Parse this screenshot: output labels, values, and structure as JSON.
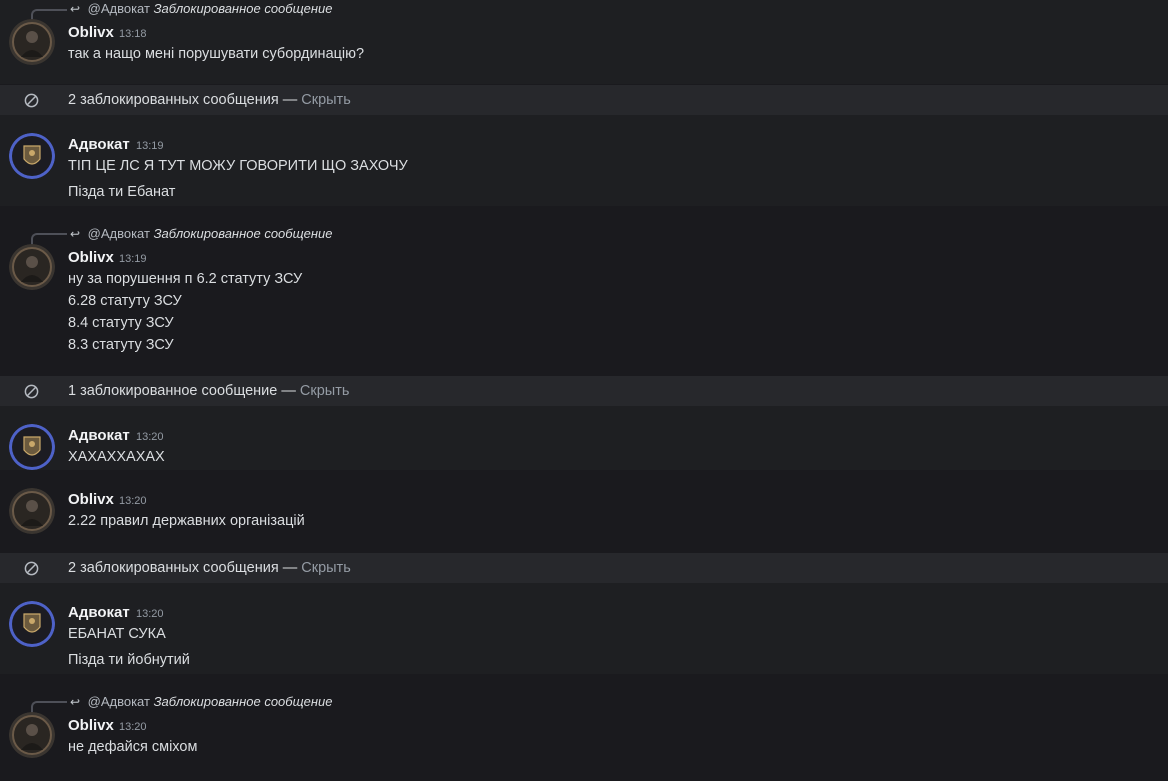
{
  "messages": [
    {
      "id": "m1",
      "reply": {
        "mention": "@Адвокат",
        "text": "Заблокированное сообщение"
      },
      "author": "Oblivx",
      "time": "13:18",
      "lines": [
        "так а нащо мені порушувати субординацію?"
      ]
    },
    {
      "id": "b1",
      "blocked_text": "2 заблокированных сообщения",
      "dash": " — ",
      "hide_label": "Скрыть"
    },
    {
      "id": "m2",
      "author": "Адвокат",
      "time": "13:19",
      "lines": [
        "ТІП ЦЕ ЛС Я ТУТ МОЖУ ГОВОРИТИ ЩО ЗАХОЧУ",
        "Пізда ти Ебанат"
      ]
    },
    {
      "id": "m3",
      "reply": {
        "mention": "@Адвокат",
        "text": "Заблокированное сообщение"
      },
      "author": "Oblivx",
      "time": "13:19",
      "lines": [
        "ну за порушення п 6.2 статуту ЗСУ",
        "6.28 статуту ЗСУ",
        "8.4 статуту ЗСУ",
        "8.3 статуту ЗСУ"
      ]
    },
    {
      "id": "b2",
      "blocked_text": "1 заблокированное сообщение",
      "dash": " — ",
      "hide_label": "Скрыть"
    },
    {
      "id": "m4",
      "author": "Адвокат",
      "time": "13:20",
      "lines": [
        "ХАХАХХАХАХ"
      ]
    },
    {
      "id": "m5",
      "author": "Oblivx",
      "time": "13:20",
      "lines": [
        "2.22 правил державних організацій"
      ]
    },
    {
      "id": "b3",
      "blocked_text": "2 заблокированных сообщения",
      "dash": " — ",
      "hide_label": "Скрыть"
    },
    {
      "id": "m6",
      "author": "Адвокат",
      "time": "13:20",
      "lines": [
        "ЕБАНАТ СУКА",
        "Пізда ти йобнутий"
      ]
    },
    {
      "id": "m7",
      "reply": {
        "mention": "@Адвокат",
        "text": "Заблокированное сообщение"
      },
      "author": "Oblivx",
      "time": "13:20",
      "lines": [
        "не дефайся сміхом"
      ]
    }
  ],
  "icons": {
    "blocked": "ban-icon",
    "reply": "reply-arrow-icon",
    "avatar_oblivx": "avatar-oblivx",
    "avatar_advokat": "avatar-advokat"
  },
  "colors": {
    "background": "#1a1a1e",
    "blocked_bar": "#27282c",
    "text": "#dbdee1",
    "muted": "#949ba4",
    "username": "#f2f3f5"
  }
}
